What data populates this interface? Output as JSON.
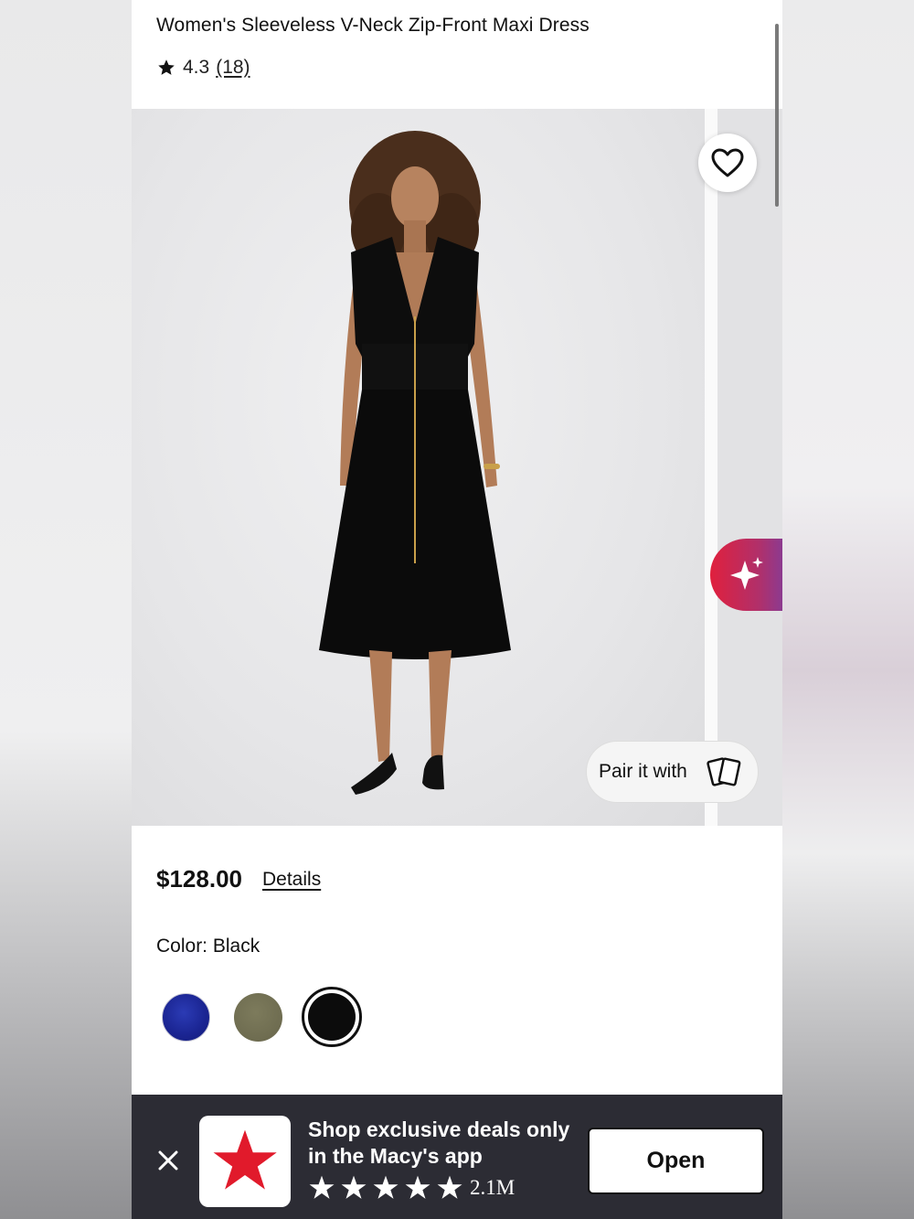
{
  "product": {
    "title": "Women's Sleeveless V-Neck Zip-Front Maxi Dress",
    "rating": "4.3",
    "review_count": "(18)",
    "price": "$128.00",
    "details_link": "Details",
    "color_label": "Color: Black",
    "swatches": [
      {
        "name": "navy",
        "color": "#1a2491"
      },
      {
        "name": "olive",
        "color": "#6e6c50"
      },
      {
        "name": "black",
        "color": "#0c0c0c",
        "selected": true
      }
    ]
  },
  "gallery": {
    "wishlist_icon": "heart-icon",
    "ai_icon": "sparkle-icon",
    "pair_label": "Pair it with",
    "pair_icon": "cards-icon"
  },
  "app_banner": {
    "line1": "Shop exclusive deals only",
    "line2": "in the Macy's app",
    "stars": 5,
    "review_count": "2.1M",
    "open_label": "Open",
    "brand_color": "#e11a2b"
  }
}
